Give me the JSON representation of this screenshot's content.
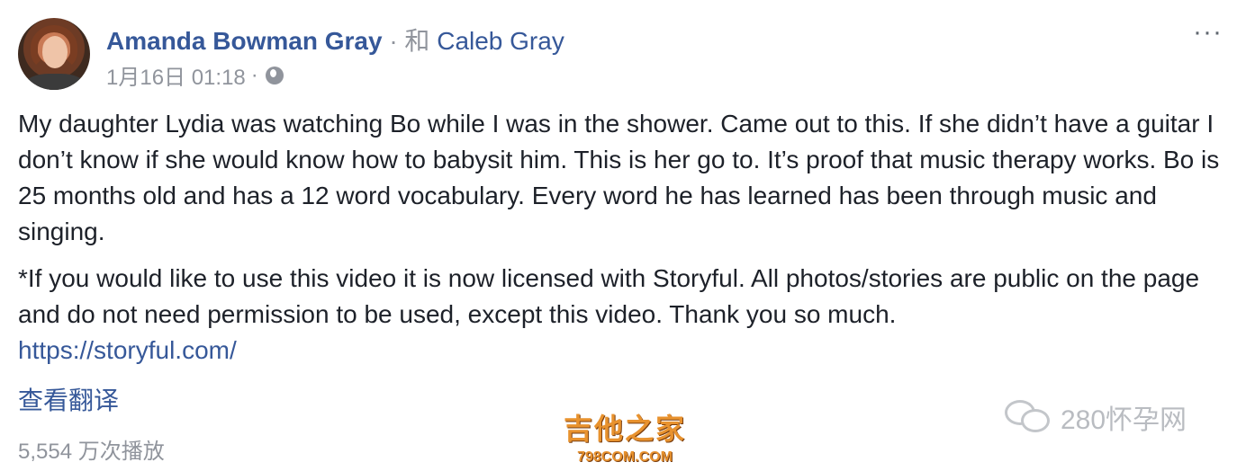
{
  "post": {
    "author": "Amanda Bowman Gray",
    "separator": "·",
    "with_prefix": "和",
    "with_name": "Caleb Gray",
    "timestamp": "1月16日 01:18",
    "meta_sep": "·",
    "privacy_icon": "globe-icon",
    "more_icon": "···",
    "paragraphs": [
      "My daughter Lydia was watching Bo while I was in the shower. Came out to this. If she didn’t have a guitar I don’t know if she would know how to babysit him. This is her go to. It’s proof that music therapy works. Bo is 25 months old and has a 12 word vocabulary. Every word he has learned has been through music and singing.",
      "*If you would like to use this video it is now licensed with Storyful. All photos/stories are public on the page and do not need permission to be used, except this video. Thank you so much."
    ],
    "link": "https://storyful.com/",
    "translate_label": "查看翻译",
    "views": "5,554 万次播放"
  },
  "watermarks": {
    "center_title": "吉他之家",
    "center_sub": "798COM.COM",
    "right_text": "280怀孕网"
  },
  "colors": {
    "link": "#365899",
    "text": "#1d2129",
    "muted": "#90949c",
    "watermark_orange": "#e8922e"
  }
}
